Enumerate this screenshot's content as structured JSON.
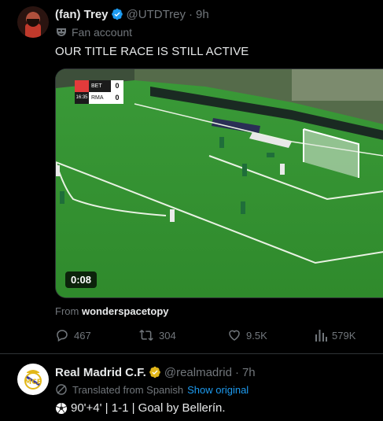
{
  "tweet1": {
    "display_name": "(fan) Trey",
    "handle": "@UTDTrey",
    "separator": "·",
    "time": "9h",
    "label": "Fan account",
    "text": "OUR TITLE RACE IS STILL ACTIVE",
    "video": {
      "duration": "0:08",
      "scorebug": {
        "clock": "16:35",
        "home": "BET",
        "away": "RMA",
        "home_score": "0",
        "away_score": "0"
      }
    },
    "from_prefix": "From",
    "from_account": "wonderspacetopy",
    "actions": {
      "replies": "467",
      "reposts": "304",
      "likes": "9.5K",
      "views": "579K"
    }
  },
  "tweet2": {
    "display_name": "Real Madrid C.F.",
    "handle": "@realmadrid",
    "separator": "·",
    "time": "7h",
    "translated_label": "Translated from Spanish",
    "show_original": "Show original",
    "text": "90'+4' | 1-1 | Goal by Bellerín."
  },
  "colors": {
    "background": "#000000",
    "text": "#e7e9ea",
    "muted": "#71767b",
    "accent": "#1d9bf0",
    "verified_blue": "#1d9bf0",
    "verified_gold": "#e2b719"
  }
}
